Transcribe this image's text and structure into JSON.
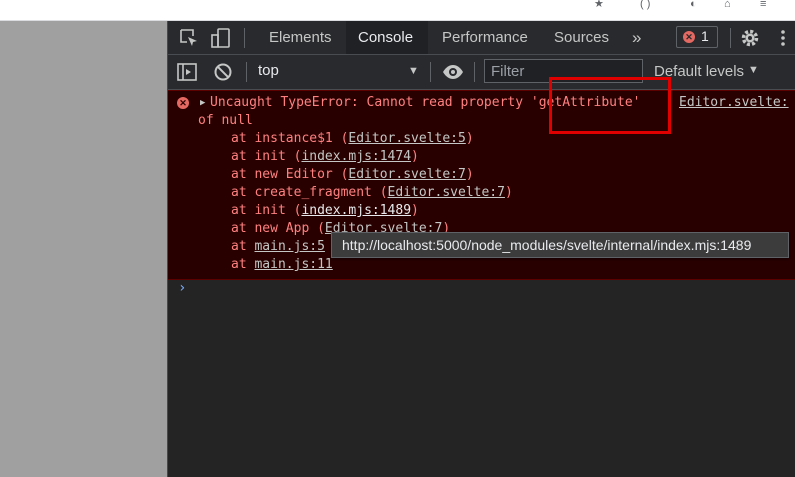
{
  "tabs": [
    {
      "label": "Elements",
      "active": false
    },
    {
      "label": "Console",
      "active": true
    },
    {
      "label": "Performance",
      "active": false
    },
    {
      "label": "Sources",
      "active": false
    }
  ],
  "more_tabs_glyph": "»",
  "error_count": "1",
  "toolbar": {
    "context": "top",
    "filter_placeholder": "Filter",
    "levels_label": "Default levels"
  },
  "error": {
    "message": "Uncaught TypeError: Cannot read property ",
    "property": "'getAttribute'",
    "message_tail": "of null",
    "source_link": "Editor.svelte:",
    "stack": [
      {
        "prefix": "at instance$1 (",
        "link": "Editor.svelte:5",
        "suffix": ")"
      },
      {
        "prefix": "at init (",
        "link": "index.mjs:1474",
        "suffix": ")"
      },
      {
        "prefix": "at new Editor (",
        "link": "Editor.svelte:7",
        "suffix": ")"
      },
      {
        "prefix": "at create_fragment (",
        "link": "Editor.svelte:7",
        "suffix": ")"
      },
      {
        "prefix": "at init (",
        "link": "index.mjs:1489",
        "suffix": ")"
      },
      {
        "prefix": "at new App (",
        "link": "Editor.svelte:7",
        "suffix": ")"
      },
      {
        "prefix": "at ",
        "link": "main.js:5",
        "suffix": ""
      },
      {
        "prefix": "at ",
        "link": "main.js:11",
        "suffix": ""
      }
    ]
  },
  "tooltip": "http://localhost:5000/node_modules/svelte/internal/index.mjs:1489",
  "colors": {
    "error_bg": "#290000",
    "error_text": "#ff8080",
    "highlight_box": "#e00000",
    "prompt": "#7cacf8"
  }
}
